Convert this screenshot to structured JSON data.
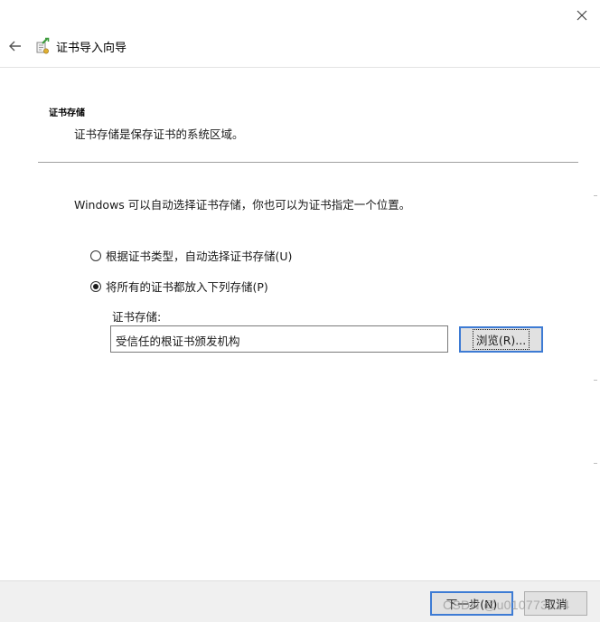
{
  "header": {
    "title": "证书导入向导",
    "back_icon": "back-arrow-icon",
    "wizard_icon": "certificate-wizard-icon",
    "close_icon": "close-icon"
  },
  "section": {
    "title": "证书存储",
    "description": "证书存储是保存证书的系统区域。"
  },
  "intro_text": "Windows 可以自动选择证书存储，你也可以为证书指定一个位置。",
  "options": {
    "auto_label": "根据证书类型，自动选择证书存储(U)",
    "auto_selected": false,
    "manual_label": "将所有的证书都放入下列存储(P)",
    "manual_selected": true
  },
  "store": {
    "label": "证书存储:",
    "value": "受信任的根证书颁发机构",
    "browse_label": "浏览(R)..."
  },
  "footer": {
    "next_label": "下一步(N)",
    "cancel_label": "取消"
  },
  "watermark": "CSDN @u010773514",
  "colors": {
    "accent": "#3d7bd4",
    "button_bg": "#e1e1e1",
    "footer_bg": "#f0f0f0",
    "separator": "#a0a0a0"
  }
}
